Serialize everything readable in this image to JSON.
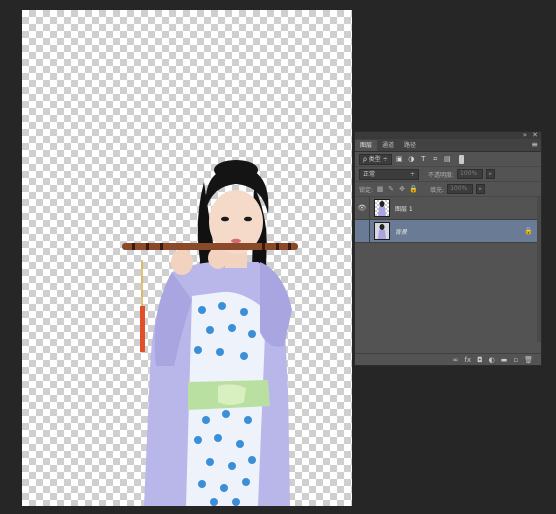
{
  "panel": {
    "tabs": [
      {
        "label": "图层",
        "active": true
      },
      {
        "label": "通道",
        "active": false
      },
      {
        "label": "路径",
        "active": false
      }
    ],
    "menu_icon": "panel-menu-icon",
    "filter": {
      "kind_label": "ρ 类型",
      "arrow": "÷"
    },
    "blend": {
      "mode": "正常",
      "opacity_label": "不透明度:",
      "opacity_value": "100%"
    },
    "lock": {
      "label": "锁定:",
      "fill_label": "填充:",
      "fill_value": "100%"
    },
    "layers": [
      {
        "name": "图层 1",
        "visible": true,
        "selected": false,
        "thumbnail": "cutout-transparent",
        "locked": false
      },
      {
        "name": "背景",
        "visible": false,
        "selected": true,
        "thumbnail": "photo",
        "locked": true
      }
    ],
    "footer_icons": [
      "link-layers-icon",
      "fx-icon",
      "add-mask-icon",
      "adjustment-layer-icon",
      "new-group-icon",
      "new-layer-icon",
      "trash-icon"
    ]
  },
  "colors": {
    "workspace": "#262626",
    "panel": "#535353",
    "selection": "#6a7b95"
  }
}
